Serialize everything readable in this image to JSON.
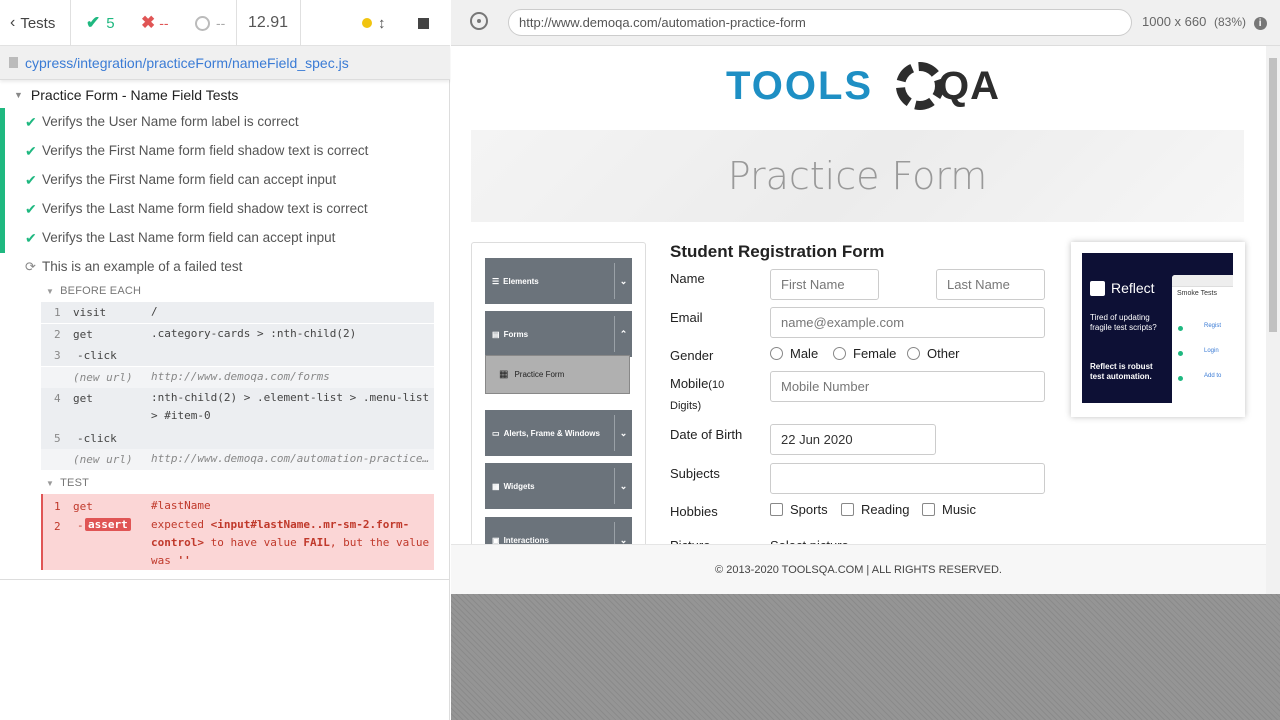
{
  "stats": {
    "back_label": "Tests",
    "passed": "5",
    "failed": "--",
    "pending": "--",
    "duration": "12.91"
  },
  "spec_path": "cypress/integration/practiceForm/nameField_spec.js",
  "suite": {
    "title": "Practice Form - Name Field Tests",
    "tests": [
      "Verifys the User Name form label is correct",
      "Verifys the First Name form field shadow text is correct",
      "Verifys the First Name form field can accept input",
      "Verifys the Last Name form field shadow text is correct",
      "Verifys the Last Name form field can accept input"
    ],
    "failed_test": "This is an example of a failed test"
  },
  "before_each": {
    "title": "BEFORE EACH",
    "commands": [
      {
        "num": "1",
        "name": "visit",
        "msg": "/"
      },
      {
        "num": "2",
        "name": "get",
        "msg": ".category-cards > :nth-child(2)"
      },
      {
        "num": "3",
        "name": "-click",
        "msg": ""
      },
      {
        "num": "",
        "name": "(new url)",
        "msg": "http://www.demoqa.com/forms"
      },
      {
        "num": "4",
        "name": "get",
        "msg": ":nth-child(2) > .element-list > .menu-list > #item-0"
      },
      {
        "num": "5",
        "name": "-click",
        "msg": ""
      },
      {
        "num": "",
        "name": "(new url)",
        "msg": "http://www.demoqa.com/automation-practice…"
      }
    ]
  },
  "test_section": {
    "title": "TEST",
    "cmd1": {
      "num": "1",
      "name": "get",
      "msg": "#lastName"
    },
    "cmd2": {
      "num": "2",
      "name": "assert",
      "msg_a": "expected",
      "msg_b": "<input#lastName..mr-sm-2.form-control>",
      "msg_c": "to have value",
      "msg_d": "FAIL",
      "msg_e": ", but the value was",
      "msg_f": "''"
    }
  },
  "url": "http://www.demoqa.com/automation-practice-form",
  "viewport": "1000 x 660",
  "zoom": "(83%)",
  "page": {
    "logo_text_a": "TOOLS",
    "logo_text_b": "QA",
    "banner_title": "Practice Form",
    "sidebar": {
      "groups": [
        "Elements",
        "Forms",
        "Alerts, Frame & Windows",
        "Widgets",
        "Interactions"
      ],
      "active_item": "Practice Form"
    },
    "form": {
      "title": "Student Registration Form",
      "name_label": "Name",
      "first_name_placeholder": "First Name",
      "last_name_placeholder": "Last Name",
      "email_label": "Email",
      "email_placeholder": "name@example.com",
      "gender_label": "Gender",
      "genders": [
        "Male",
        "Female",
        "Other"
      ],
      "mobile_label": "Mobile",
      "mobile_hint": "(10 Digits)",
      "mobile_placeholder": "Mobile Number",
      "dob_label": "Date of Birth",
      "dob_value": "22 Jun 2020",
      "subjects_label": "Subjects",
      "hobbies_label": "Hobbies",
      "hobbies": [
        "Sports",
        "Reading",
        "Music"
      ],
      "picture_label": "Picture",
      "picture_value": "Select picture"
    },
    "ad": {
      "brand": "Reflect",
      "text1": "Tired of updating fragile test scripts?",
      "text2": "Reflect is robust test automation.",
      "panel_title": "Smoke Tests",
      "items": [
        "Regist",
        "Login",
        "Add to"
      ]
    },
    "footer": "© 2013-2020 TOOLSQA.COM | ALL RIGHTS RESERVED."
  },
  "colors": {
    "pass": "#1fb880",
    "fail": "#e05555",
    "link": "#3a7bd5",
    "logo_blue": "#1e8fc4",
    "logo_dark": "#2d2d2d"
  }
}
